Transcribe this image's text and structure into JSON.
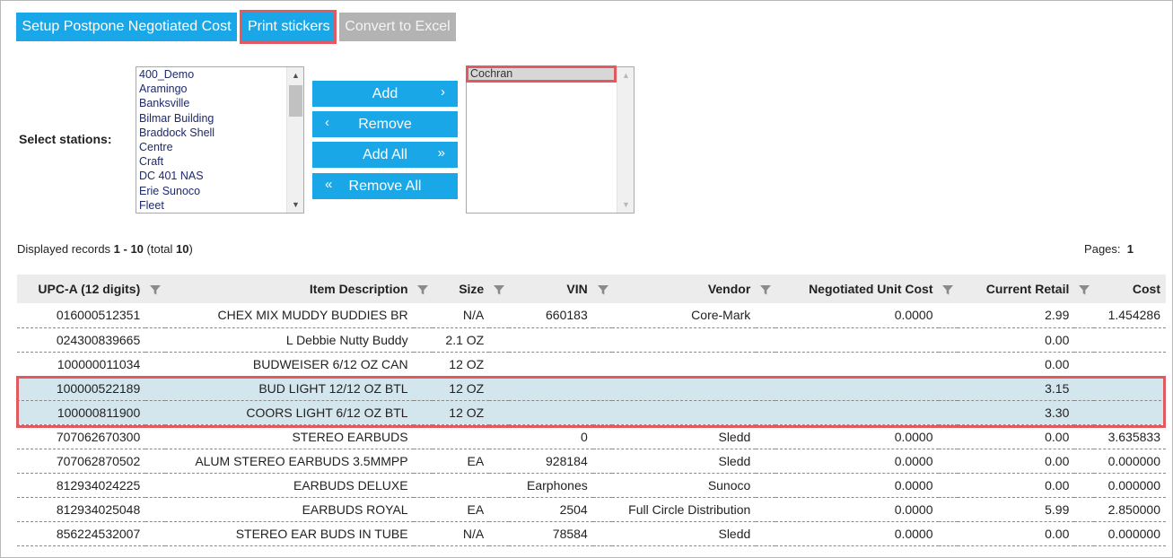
{
  "toolbar": {
    "setup_label": "Setup Postpone Negotiated Cost",
    "print_label": "Print stickers",
    "excel_label": "Convert to Excel"
  },
  "stations": {
    "label": "Select stations:",
    "available": [
      "400_Demo",
      "Aramingo",
      "Banksville",
      "Bilmar Building",
      "Braddock Shell",
      "Centre",
      "Craft",
      "DC 401 NAS",
      "Erie Sunoco",
      "Fleet"
    ],
    "selected": [
      "Cochran"
    ],
    "add_label": "Add",
    "remove_label": "Remove",
    "add_all_label": "Add All",
    "remove_all_label": "Remove All"
  },
  "records": {
    "prefix": "Displayed records ",
    "range": "1 - 10",
    "total_prefix": " (total ",
    "total": "10",
    "suffix": ")",
    "pages_label": "Pages:",
    "pages_value": "1"
  },
  "table": {
    "headers": [
      "UPC-A (12 digits)",
      "Item Description",
      "Size",
      "VIN",
      "Vendor",
      "Negotiated Unit Cost",
      "Current Retail",
      "Cost"
    ],
    "rows": [
      [
        "016000512351",
        "CHEX MIX MUDDY BUDDIES BR",
        "N/A",
        "660183",
        "Core-Mark",
        "0.0000",
        "2.99",
        "1.454286"
      ],
      [
        "024300839665",
        "L Debbie Nutty Buddy",
        "2.1 OZ",
        "",
        "",
        "",
        "0.00",
        ""
      ],
      [
        "100000011034",
        "BUDWEISER 6/12 OZ CAN",
        "12 OZ",
        "",
        "",
        "",
        "0.00",
        ""
      ],
      [
        "100000522189",
        "BUD LIGHT 12/12 OZ BTL",
        "12 OZ",
        "",
        "",
        "",
        "3.15",
        ""
      ],
      [
        "100000811900",
        "COORS LIGHT 6/12 OZ BTL",
        "12 OZ",
        "",
        "",
        "",
        "3.30",
        ""
      ],
      [
        "707062670300",
        "STEREO EARBUDS",
        "",
        "0",
        "Sledd",
        "0.0000",
        "0.00",
        "3.635833"
      ],
      [
        "707062870502",
        "ALUM STEREO EARBUDS 3.5MMPP",
        "EA",
        "928184",
        "Sledd",
        "0.0000",
        "0.00",
        "0.000000"
      ],
      [
        "812934024225",
        "EARBUDS DELUXE",
        "",
        "Earphones",
        "Sunoco",
        "0.0000",
        "0.00",
        "0.000000"
      ],
      [
        "812934025048",
        "EARBUDS ROYAL",
        "EA",
        "2504",
        "Full Circle Distribution",
        "0.0000",
        "5.99",
        "2.850000"
      ],
      [
        "856224532007",
        "STEREO EAR BUDS IN TUBE",
        "N/A",
        "78584",
        "Sledd",
        "0.0000",
        "0.00",
        "0.000000"
      ]
    ],
    "selected_rows": [
      3,
      4
    ]
  },
  "colors": {
    "accent": "#1aa7e8",
    "disabled": "#b3b3b3",
    "highlight": "#e05a5f",
    "selected_row": "#d3e5ed"
  }
}
